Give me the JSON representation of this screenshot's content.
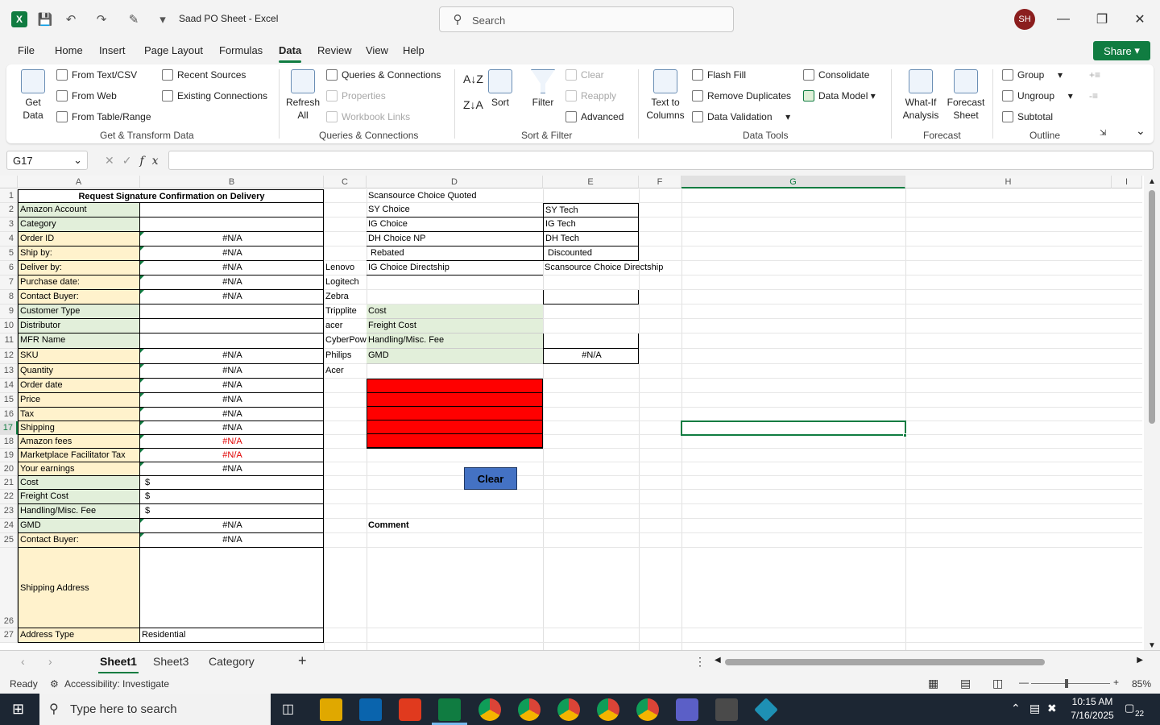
{
  "app": {
    "doc_title": "Saad PO Sheet  -  Excel",
    "search_placeholder": "Search",
    "avatar": "SH"
  },
  "menu": [
    "File",
    "Home",
    "Insert",
    "Page Layout",
    "Formulas",
    "Data",
    "Review",
    "View",
    "Help"
  ],
  "share_label": "Share",
  "ribbon": {
    "get_data": "Get\nData",
    "get_transform": [
      "From Text/CSV",
      "From Web",
      "From Table/Range",
      "Recent Sources",
      "Existing Connections"
    ],
    "group_get_transform": "Get & Transform Data",
    "refresh": "Refresh\nAll",
    "queries": [
      "Queries & Connections",
      "Properties",
      "Workbook Links"
    ],
    "group_queries": "Queries & Connections",
    "sort_label": "Sort",
    "filter_label": "Filter",
    "filter_opts": [
      "Clear",
      "Reapply",
      "Advanced"
    ],
    "group_sort": "Sort & Filter",
    "text_to_columns": "Text to\nColumns",
    "data_tools": [
      "Flash Fill",
      "Remove Duplicates",
      "Data Validation",
      "Consolidate",
      "Data Model"
    ],
    "group_data_tools": "Data Tools",
    "what_if": "What-If\nAnalysis",
    "forecast_sheet": "Forecast\nSheet",
    "group_forecast": "Forecast",
    "outline": [
      "Group",
      "Ungroup",
      "Subtotal"
    ],
    "group_outline": "Outline"
  },
  "formula_bar": {
    "name_box": "G17",
    "formula": ""
  },
  "columns": [
    "A",
    "B",
    "C",
    "D",
    "E",
    "F",
    "G",
    "H",
    "I"
  ],
  "colA": [
    "Request Signature Confirmation on Delivery",
    "Amazon Account",
    "Category",
    "Order ID",
    "Ship by:",
    "Deliver by:",
    "Purchase date:",
    "Contact Buyer:",
    "Customer Type",
    "Distributor",
    "MFR Name",
    "SKU",
    "Quantity",
    "Order date",
    "Price",
    "Tax",
    "Shipping",
    "Amazon fees",
    "Marketplace Facilitator Tax",
    "Your earnings",
    "Cost",
    "Freight Cost",
    "Handling/Misc. Fee",
    "GMD",
    "Contact Buyer:",
    "Shipping Address",
    "Address Type"
  ],
  "colB": [
    "",
    "",
    "",
    "#N/A",
    "#N/A",
    "#N/A",
    "#N/A",
    "#N/A",
    "",
    "",
    "",
    "#N/A",
    "#N/A",
    "#N/A",
    "#N/A",
    "#N/A",
    "#N/A",
    "#N/A",
    "#N/A",
    "#N/A",
    "$",
    "$",
    "$",
    "#N/A",
    "#N/A",
    "",
    "Residential"
  ],
  "dash": "-",
  "colC": [
    "Lenovo",
    "Logitech",
    "Zebra",
    "Tripplite",
    "acer",
    "CyberPower",
    "Philips",
    "Acer"
  ],
  "colD": [
    "Scansource Choice Quoted",
    "SY Choice",
    "IG Choice",
    "DH Choice NP",
    "Rebated",
    "IG Choice Directship",
    "",
    "",
    "Cost",
    "Freight Cost",
    "Handling/Misc. Fee",
    "GMD"
  ],
  "colE": [
    "",
    "SY Tech",
    "IG Tech",
    "DH Tech",
    "Discounted",
    "Scansource Choice Directship",
    "",
    "",
    "",
    "",
    "",
    "#N/A"
  ],
  "clear_button": "Clear",
  "comment_label": "Comment",
  "sheets": [
    "Sheet1",
    "Sheet3",
    "Category"
  ],
  "status": {
    "ready": "Ready",
    "accessibility": "Accessibility: Investigate",
    "zoom": "85%"
  },
  "taskbar": {
    "search": "Type here to search",
    "time": "10:15 AM",
    "date": "7/16/2025",
    "notif": "22"
  },
  "colors": {
    "accent": "#107c41",
    "yellow": "#fff2cc",
    "green": "#e2efda",
    "red": "#ff0000",
    "button": "#4472c4"
  }
}
